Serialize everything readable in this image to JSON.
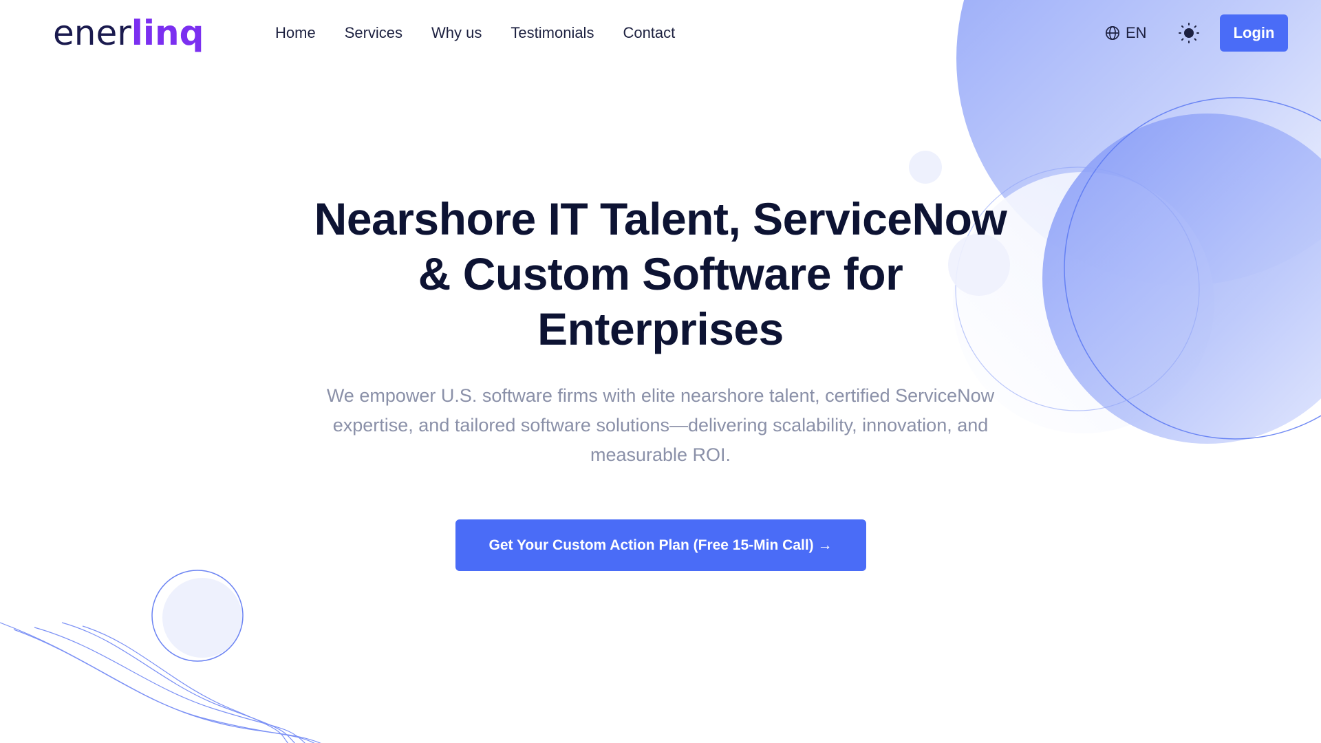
{
  "brand": {
    "logo_part1": "ener",
    "logo_part2": "linq",
    "colors": {
      "logo_dark": "#1a1a4e",
      "logo_accent": "#7b2ff0",
      "primary": "#4a6cf7",
      "heading": "#0d1333",
      "muted": "#8a90a8"
    }
  },
  "nav": {
    "items": [
      {
        "label": "Home"
      },
      {
        "label": "Services"
      },
      {
        "label": "Why us"
      },
      {
        "label": "Testimonials"
      },
      {
        "label": "Contact"
      }
    ]
  },
  "header": {
    "language_icon": "globe-icon",
    "language_label": "EN",
    "theme_icon": "sun-icon",
    "login_label": "Login"
  },
  "hero": {
    "title_line1": "Nearshore IT Talent, ServiceNow",
    "title_line2": "& Custom Software for",
    "title_line3": "Enterprises",
    "subtitle": "We empower U.S. software firms with elite nearshore talent, certified ServiceNow expertise, and tailored software solutions—delivering scalability, innovation, and measurable ROI.",
    "cta_label": "Get Your Custom Action Plan (Free 15-Min Call) →"
  }
}
